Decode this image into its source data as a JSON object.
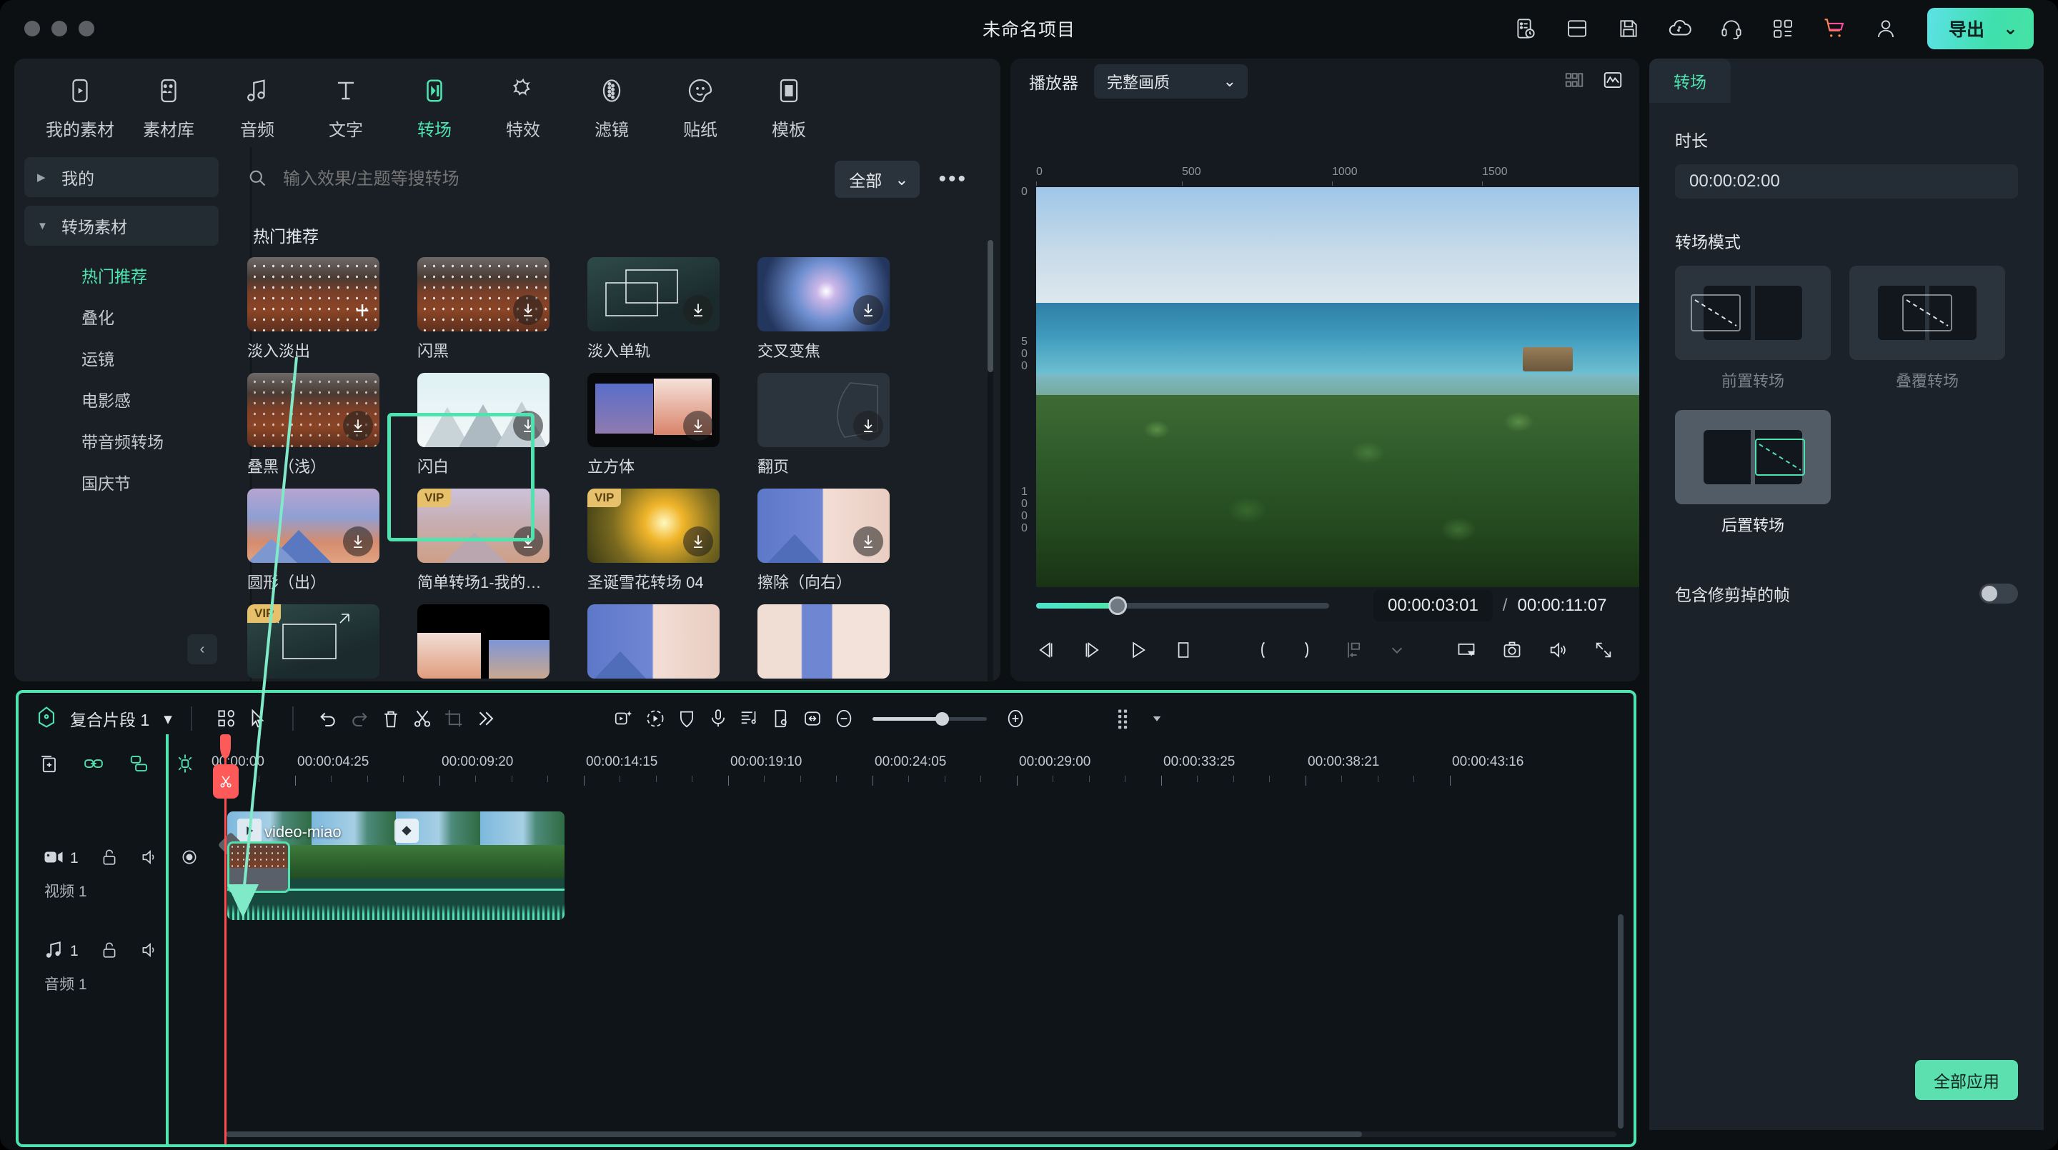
{
  "titlebar": {
    "project_title": "未命名项目",
    "icons": [
      "history-icon",
      "layout-icon",
      "save-icon",
      "cloud-upload-icon",
      "headset-support-icon",
      "apps-grid-icon",
      "cart-icon",
      "user-account-icon"
    ],
    "export_label": "导出",
    "export_caret": "⌄"
  },
  "left_panel": {
    "tabs": [
      {
        "label": "我的素材",
        "icon": "my-media-icon",
        "active": false
      },
      {
        "label": "素材库",
        "icon": "stock-library-icon",
        "active": false
      },
      {
        "label": "音频",
        "icon": "audio-icon",
        "active": false
      },
      {
        "label": "文字",
        "icon": "text-icon",
        "active": false
      },
      {
        "label": "转场",
        "icon": "transition-icon",
        "active": true
      },
      {
        "label": "特效",
        "icon": "effects-icon",
        "active": false
      },
      {
        "label": "滤镜",
        "icon": "filter-icon",
        "active": false
      },
      {
        "label": "贴纸",
        "icon": "sticker-icon",
        "active": false
      },
      {
        "label": "模板",
        "icon": "template-icon",
        "active": false
      }
    ],
    "categories": [
      {
        "label": "我的",
        "type": "group",
        "expanded": false
      },
      {
        "label": "转场素材",
        "type": "group",
        "expanded": true
      },
      {
        "label": "热门推荐",
        "type": "sub",
        "active": true
      },
      {
        "label": "叠化",
        "type": "sub",
        "active": false
      },
      {
        "label": "运镜",
        "type": "sub",
        "active": false
      },
      {
        "label": "电影感",
        "type": "sub",
        "active": false
      },
      {
        "label": "带音频转场",
        "type": "sub",
        "active": false
      },
      {
        "label": "国庆节",
        "type": "sub",
        "active": false
      }
    ],
    "collapse_label": "‹",
    "search": {
      "placeholder": "输入效果/主题等搜转场",
      "value": "",
      "filter_label": "全部",
      "more_label": "•••"
    },
    "section_title": "热门推荐",
    "items": [
      {
        "name": "淡入淡出",
        "art": "art-dots",
        "selected": true,
        "vip": false,
        "download": false,
        "plus": true
      },
      {
        "name": "闪黑",
        "art": "art-dots",
        "selected": false,
        "vip": false,
        "download": true,
        "plus": false
      },
      {
        "name": "淡入单轨",
        "art": "art-teal",
        "selected": false,
        "vip": false,
        "download": true,
        "plus": false
      },
      {
        "name": "交叉变焦",
        "art": "art-sky",
        "selected": false,
        "vip": false,
        "download": true,
        "plus": false
      },
      {
        "name": "叠黑（浅）",
        "art": "art-dots light",
        "selected": false,
        "vip": false,
        "download": true,
        "plus": false
      },
      {
        "name": "闪白",
        "art": "art-white",
        "selected": false,
        "vip": false,
        "download": true,
        "plus": false
      },
      {
        "name": "立方体",
        "art": "art-cube",
        "selected": false,
        "vip": false,
        "download": true,
        "plus": false
      },
      {
        "name": "翻页",
        "art": "art-flat",
        "selected": false,
        "vip": false,
        "download": true,
        "plus": false
      },
      {
        "name": "圆形（出）",
        "art": "art-mtn",
        "selected": false,
        "vip": false,
        "download": true,
        "plus": false
      },
      {
        "name": "简单转场1-我的…",
        "art": "art-mtn2",
        "selected": false,
        "vip": true,
        "download": true,
        "plus": false
      },
      {
        "name": "圣诞雪花转场 04",
        "art": "art-xmas",
        "selected": false,
        "vip": true,
        "download": true,
        "plus": false
      },
      {
        "name": "擦除（向右）",
        "art": "art-split",
        "selected": false,
        "vip": false,
        "download": true,
        "plus": false
      },
      {
        "name": "",
        "art": "art-teal",
        "selected": false,
        "vip": true,
        "download": false,
        "plus": false
      },
      {
        "name": "",
        "art": "art-blackbar",
        "selected": false,
        "vip": false,
        "download": false,
        "plus": false
      },
      {
        "name": "",
        "art": "art-split",
        "selected": false,
        "vip": false,
        "download": false,
        "plus": false
      },
      {
        "name": "",
        "art": "art-split2",
        "selected": false,
        "vip": false,
        "download": false,
        "plus": false
      }
    ]
  },
  "player": {
    "label": "播放器",
    "quality": "完整画质",
    "quality_caret": "⌄",
    "right_icons": [
      "grid-view-icon",
      "waveform-scope-icon"
    ],
    "ruler_h_ticks": [
      "0",
      "500",
      "1000",
      "1500"
    ],
    "ruler_v_ticks": [
      "0",
      "500",
      "1000"
    ],
    "current_time": "00:00:03:01",
    "separator": "/",
    "total_time": "00:00:11:07",
    "controls": [
      "prev-frame-icon",
      "next-frame-icon",
      "play-icon",
      "stop-icon",
      "mark-in-icon",
      "mark-out-icon",
      "split-marker-icon",
      "chevron-down-icon",
      "screen-cast-icon",
      "snapshot-icon",
      "volume-icon",
      "fullscreen-icon"
    ]
  },
  "right_panel": {
    "tab_label": "转场",
    "duration_label": "时长",
    "duration_value": "00:00:02:00",
    "mode_label": "转场模式",
    "modes": [
      {
        "label": "前置转场",
        "selected": false,
        "enabled": false
      },
      {
        "label": "叠覆转场",
        "selected": false,
        "enabled": false
      },
      {
        "label": "后置转场",
        "selected": true,
        "enabled": true
      }
    ],
    "trim_toggle_label": "包含修剪掉的帧",
    "trim_toggle_on": false,
    "apply_all_label": "全部应用"
  },
  "timeline": {
    "segment_label": "复合片段 1",
    "segment_caret": "▾",
    "toolbar_icons_left": [
      "group-split-icon",
      "select-cursor-icon",
      "undo-icon",
      "redo-icon",
      "delete-icon",
      "scissors-icon",
      "crop-icon",
      "more-chevrons-icon"
    ],
    "toolbar_icons_right": [
      "ai-tools-icon",
      "speed-icon",
      "mask-icon",
      "record-voice-icon",
      "auto-beat-icon",
      "auto-reframe-icon",
      "fit-timeline-icon",
      "zoom-out-icon",
      "zoom-in-icon",
      "track-manager-icon",
      "track-caret-icon"
    ],
    "subbar_icons": [
      "add-track-icon",
      "link-icon",
      "snap-group-icon",
      "marker-icon"
    ],
    "ruler_ticks": [
      "00:00:00",
      "00:00:04:25",
      "00:00:09:20",
      "00:00:14:15",
      "00:00:19:10",
      "00:00:24:05",
      "00:00:29:00",
      "00:00:33:25",
      "00:00:38:21",
      "00:00:43:16"
    ],
    "tracks": [
      {
        "name": "视频 1",
        "count": "1",
        "type": "video",
        "icons": [
          "video-track-icon",
          "unlock-icon",
          "speaker-icon",
          "eye-icon"
        ]
      },
      {
        "name": "音频 1",
        "count": "1",
        "type": "audio",
        "icons": [
          "audio-track-icon",
          "unlock-icon",
          "speaker-icon"
        ]
      }
    ],
    "clip": {
      "label": "video-miao",
      "has_transition": true
    }
  }
}
